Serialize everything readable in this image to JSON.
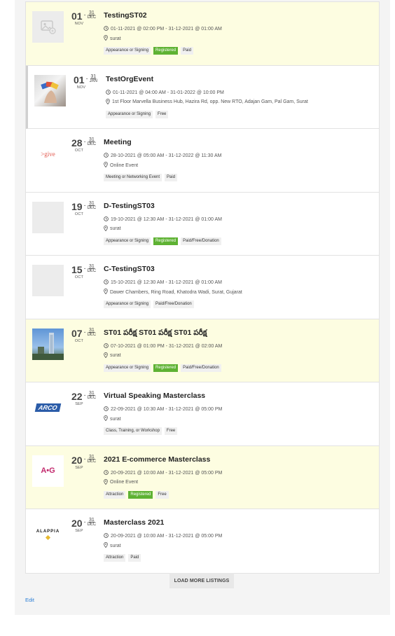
{
  "listings": [
    {
      "title": "TestingST02",
      "day": "01",
      "end_day": "31",
      "end_mon": "DEC",
      "mon": "NOV",
      "time": "01-11-2021 @ 02:00 PM - 31-12-2021 @ 01:00 AM",
      "location": "surat",
      "tags": [
        "Appearance or Signing",
        "Registered",
        "Paid"
      ],
      "thumb": "placeholder-image-icon"
    },
    {
      "title": "TestOrgEvent",
      "day": "01",
      "end_day": "31",
      "end_mon": "JAN",
      "mon": "NOV",
      "time": "01-11-2021 @ 04:00 AM - 31-01-2022 @ 10:00 PM",
      "location": "1st Floor Marvella Business Hub, Hazira Rd, opp. New RTO, Adajan Gam, Pal Gam, Surat",
      "tags": [
        "Appearance or Signing",
        "Free"
      ],
      "thumb": "photo-hand-cards"
    },
    {
      "title": "Meeting",
      "day": "28",
      "end_day": "31",
      "end_mon": "DEC",
      "mon": "OCT",
      "time": "28-10-2021 @ 05:00 AM - 31-12-2022 @ 11:30 AM",
      "location": "Online Event",
      "tags": [
        "Meeting or Networking Event",
        "Paid"
      ],
      "thumb": "give-logo",
      "logo_text": ">give"
    },
    {
      "title": "D-TestingST03",
      "day": "19",
      "end_day": "31",
      "end_mon": "DEC",
      "mon": "OCT",
      "time": "19-10-2021 @ 12:30 AM - 31-12-2021 @ 01:00 AM",
      "location": "surat",
      "tags": [
        "Appearance or Signing",
        "Registered",
        "Paid/Free/Donation"
      ],
      "thumb": "blank"
    },
    {
      "title": "C-TestingST03",
      "day": "15",
      "end_day": "31",
      "end_mon": "DEC",
      "mon": "OCT",
      "time": "15-10-2021 @ 12:30 AM - 31-12-2021 @ 01:00 AM",
      "location": "Dawer Chambers, Ring Road, Khatodra Wadi, Surat, Gujarat",
      "tags": [
        "Appearance or Signing",
        "Paid/Free/Donation"
      ],
      "thumb": "blank"
    },
    {
      "title": "ST01 పరీక్ష ST01 పరీక్ష ST01 పరీక్ష",
      "day": "07",
      "end_day": "31",
      "end_mon": "DEC",
      "mon": "OCT",
      "time": "07-10-2021 @ 01:00 PM - 31-12-2021 @ 02:00 AM",
      "location": "surat",
      "tags": [
        "Appearance or Signing",
        "Registered",
        "Paid/Free/Donation"
      ],
      "thumb": "photo-tower"
    },
    {
      "title": "Virtual Speaking Masterclass",
      "day": "22",
      "end_day": "31",
      "end_mon": "DEC",
      "mon": "SEP",
      "time": "22-09-2021 @ 10:30 AM - 31-12-2021 @ 05:00 PM",
      "location": "surat",
      "tags": [
        "Class, Training, or Workshop",
        "Free"
      ],
      "thumb": "arco-logo",
      "logo_text": "ARCO"
    },
    {
      "title": "2021 E-commerce Masterclass",
      "day": "20",
      "end_day": "31",
      "end_mon": "DEC",
      "mon": "SEP",
      "time": "20-09-2021 @ 10:00 AM - 31-12-2021 @ 05:00 PM",
      "location": "Online Event",
      "tags": [
        "Attraction",
        "Registered",
        "Free"
      ],
      "thumb": "ag-logo",
      "logo_text": "A•G"
    },
    {
      "title": "Masterclass 2021",
      "day": "20",
      "end_day": "31",
      "end_mon": "DEC",
      "mon": "SEP",
      "time": "20-09-2021 @ 10:00 AM - 31-12-2021 @ 05:00 PM",
      "location": "surat",
      "tags": [
        "Attraction",
        "Paid"
      ],
      "thumb": "alappia-logo",
      "logo_text": "ALAPPIA"
    }
  ],
  "highlighted": [
    0,
    5,
    7
  ],
  "selected": [
    1
  ],
  "load_more_label": "LOAD MORE LISTINGS",
  "edit_label": "Edit",
  "colors": {
    "registered": "#5eb233",
    "highlight": "#fdfde1",
    "link": "#2a7ed6"
  }
}
